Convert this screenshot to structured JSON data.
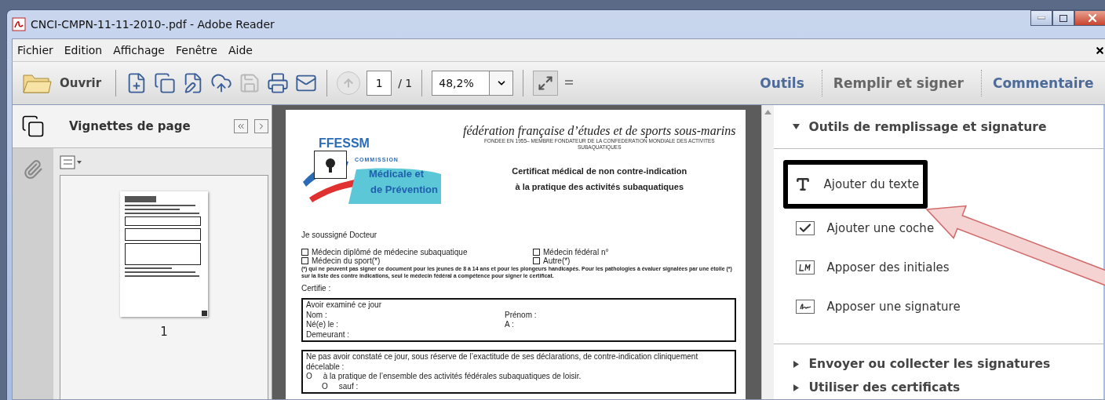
{
  "window": {
    "title": "CNCI-CMPN-11-11-2010-.pdf - Adobe Reader"
  },
  "menu": [
    {
      "label": "Fichier"
    },
    {
      "label": "Edition"
    },
    {
      "label": "Affichage"
    },
    {
      "label": "Fenêtre"
    },
    {
      "label": "Aide"
    }
  ],
  "toolbar": {
    "open_label": "Ouvrir",
    "tools": [
      {
        "kind": "create",
        "disabled": false
      },
      {
        "kind": "convert",
        "disabled": false
      },
      {
        "kind": "edit",
        "disabled": false
      },
      {
        "kind": "cloud",
        "disabled": false
      },
      {
        "kind": "save",
        "disabled": true
      },
      {
        "kind": "print",
        "disabled": false
      },
      {
        "kind": "mail",
        "disabled": false
      }
    ],
    "page_up_disabled": true,
    "page_value": "1",
    "page_total": "/ 1",
    "zoom_value": "48,2%"
  },
  "panel_tabs": [
    {
      "label": "Outils",
      "selected": false
    },
    {
      "label": "Remplir et signer",
      "selected": true
    },
    {
      "label": "Commentaire",
      "selected": false
    }
  ],
  "thumbnails": {
    "title": "Vignettes de page",
    "pages": [
      {
        "label": "1",
        "selected": true
      }
    ]
  },
  "document": {
    "logo": [
      "FFESSM",
      "COMMISSION",
      "Médicale et",
      "de Prévention"
    ],
    "heading": "fédération française d’études et de sports sous-marins",
    "subheading": "FONDEE EN 1955– MEMBRE FONDATEUR DE LA CONFEDERATION MONDIALE DES ACTIVITES SUBAQUATIQUES",
    "title_lines": [
      "Certificat médical de non contre-indication",
      "à la pratique des activités subaquatiques"
    ],
    "intro": "Je soussigné Docteur",
    "options": [
      {
        "label": "Médecin diplômé de médecine subaquatique",
        "checked": false
      },
      {
        "label": "Médecin fédéral n°",
        "checked": false
      },
      {
        "label": "Médecin du sport(*)",
        "checked": false
      },
      {
        "label": "Autre(*)",
        "checked": false
      }
    ],
    "note": "(*) qui ne peuvent pas signer ce document pour les jeunes de 8 à 14 ans et pour les plongeurs handicapés. Pour les pathologies à évaluer signalées par une étoile (*) sur la liste des contre indications, seul le médecin fédéral a compétence pour signer le certificat.",
    "certify": "Certifie :",
    "exam_box": {
      "title": "Avoir examiné ce jour",
      "fields": [
        [
          "Nom :",
          "Prénom :"
        ],
        [
          "Né(e) le :",
          "A :"
        ],
        [
          "Demeurant :"
        ]
      ]
    },
    "finding_box": {
      "text": "Ne pas avoir constaté ce jour, sous réserve de l’exactitude de ses déclarations, de contre-indication cliniquement décelable :",
      "choices": [
        {
          "mark": "O",
          "label": "à la pratique de l’ensemble des activités fédérales subaquatiques de loisir.",
          "indented": false
        },
        {
          "mark": "O",
          "label": "sauf :",
          "indented": true
        }
      ]
    }
  },
  "fill_sign": {
    "sections": [
      {
        "title": "Outils de remplissage et signature",
        "expanded": true,
        "items": [
          {
            "kind": "text",
            "label": "Ajouter du texte",
            "highlighted": true
          },
          {
            "kind": "check",
            "label": "Ajouter une coche",
            "highlighted": false
          },
          {
            "kind": "initials",
            "label": "Apposer des initiales",
            "highlighted": false
          },
          {
            "kind": "signature",
            "label": "Apposer une signature",
            "highlighted": false
          }
        ]
      },
      {
        "title": "Envoyer ou collecter les signatures",
        "expanded": false
      },
      {
        "title": "Utiliser des certificats",
        "expanded": false
      }
    ]
  }
}
